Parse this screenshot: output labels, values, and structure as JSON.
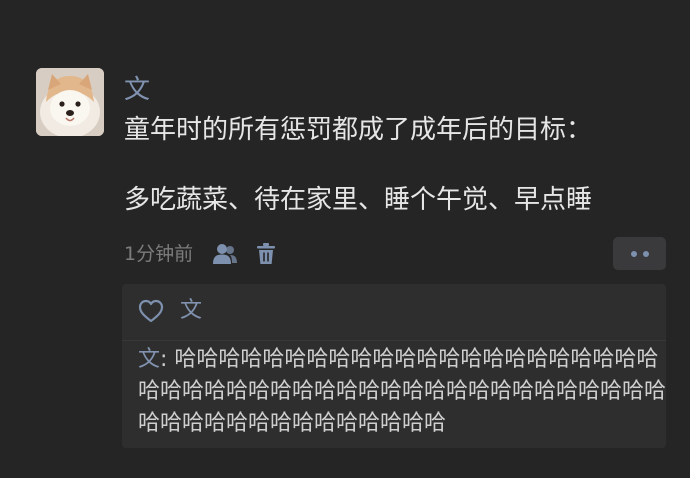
{
  "post": {
    "author": "文",
    "text": "童年时的所有惩罚都成了成年后的目标：\n\n多吃蔬菜、待在家里、睡个午觉、早点睡",
    "time": "1分钟前"
  },
  "icons": {
    "avatar": "shiba-dog-avatar",
    "privacy": "people-icon",
    "delete": "trash-icon",
    "more": "more-dots-icon",
    "like": "heart-outline-icon"
  },
  "likes": {
    "names": "文"
  },
  "comments": [
    {
      "author": "文",
      "separator": ": ",
      "text": "哈哈哈哈哈哈哈哈哈哈哈哈哈哈哈哈哈哈哈哈哈哈哈哈哈哈哈哈哈哈哈哈哈哈哈哈哈哈哈哈哈哈哈哈哈哈哈哈哈哈哈哈哈哈哈哈哈哈哈哈"
    }
  ],
  "colors": {
    "background": "#252525",
    "name": "#8193b0",
    "text": "#e6e6e6",
    "muted": "#7c7c7c",
    "panel": "#2e2e2e"
  }
}
